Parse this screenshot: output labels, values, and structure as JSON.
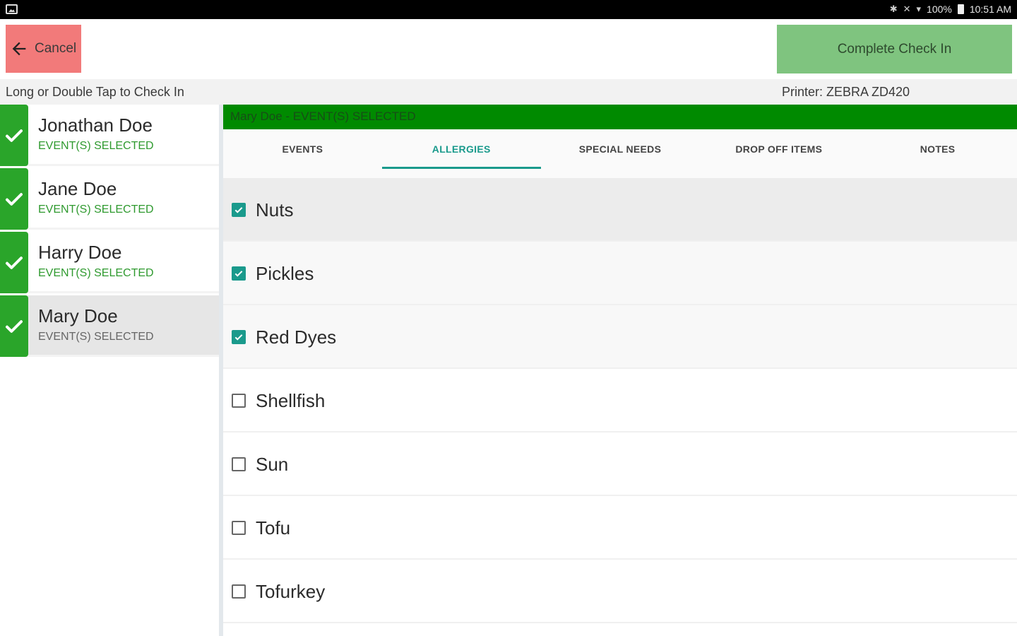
{
  "status_bar": {
    "text": "100%",
    "time": "10:51 AM"
  },
  "toolbar": {
    "cancel_label": "Cancel",
    "complete_label": "Complete Check In"
  },
  "info": {
    "hint": "Long or Double Tap to Check In",
    "printer": "Printer:  ZEBRA ZD420"
  },
  "people": [
    {
      "name": "Jonathan Doe",
      "status": "EVENT(S) SELECTED",
      "selected": false
    },
    {
      "name": "Jane Doe",
      "status": "EVENT(S) SELECTED",
      "selected": false
    },
    {
      "name": "Harry Doe",
      "status": "EVENT(S) SELECTED",
      "selected": false
    },
    {
      "name": "Mary Doe",
      "status": "EVENT(S) SELECTED",
      "selected": true
    }
  ],
  "main": {
    "header": "Mary Doe - EVENT(S) SELECTED",
    "tabs": [
      {
        "label": "EVENTS",
        "active": false
      },
      {
        "label": "ALLERGIES",
        "active": true
      },
      {
        "label": "SPECIAL NEEDS",
        "active": false
      },
      {
        "label": "DROP OFF ITEMS",
        "active": false
      },
      {
        "label": "NOTES",
        "active": false
      }
    ],
    "allergies": [
      {
        "label": "Nuts",
        "checked": true
      },
      {
        "label": "Pickles",
        "checked": true
      },
      {
        "label": "Red Dyes",
        "checked": true
      },
      {
        "label": "Shellfish",
        "checked": false
      },
      {
        "label": "Sun",
        "checked": false
      },
      {
        "label": "Tofu",
        "checked": false
      },
      {
        "label": "Tofurkey",
        "checked": false
      }
    ]
  },
  "colors": {
    "accent_teal": "#1a9a8c",
    "check_green": "#2aa52a",
    "header_green": "#008a00",
    "cancel_red": "#f27a7a",
    "complete_green": "#7fc47f"
  }
}
